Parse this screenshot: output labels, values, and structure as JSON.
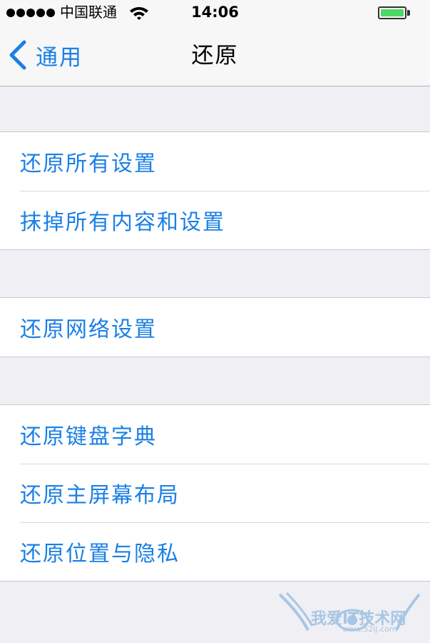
{
  "status_bar": {
    "carrier": "中国联通",
    "time": "14:06",
    "signal_dots": 5,
    "battery_level": 1.0
  },
  "nav": {
    "back_label": "通用",
    "title": "还原"
  },
  "groups": [
    {
      "items": [
        {
          "label": "还原所有设置"
        },
        {
          "label": "抹掉所有内容和设置"
        }
      ]
    },
    {
      "items": [
        {
          "label": "还原网络设置"
        }
      ]
    },
    {
      "items": [
        {
          "label": "还原键盘字典"
        },
        {
          "label": "还原主屏幕布局"
        },
        {
          "label": "还原位置与隐私"
        }
      ]
    }
  ],
  "watermark": {
    "text": "我爱IT技术网",
    "sub_text": "www.52ij.com"
  },
  "colors": {
    "accent": "#1a7fe6",
    "background": "#efeff4",
    "battery": "#4cd964"
  },
  "icons": [
    "wifi-icon",
    "battery-icon",
    "back-chevron-icon"
  ]
}
